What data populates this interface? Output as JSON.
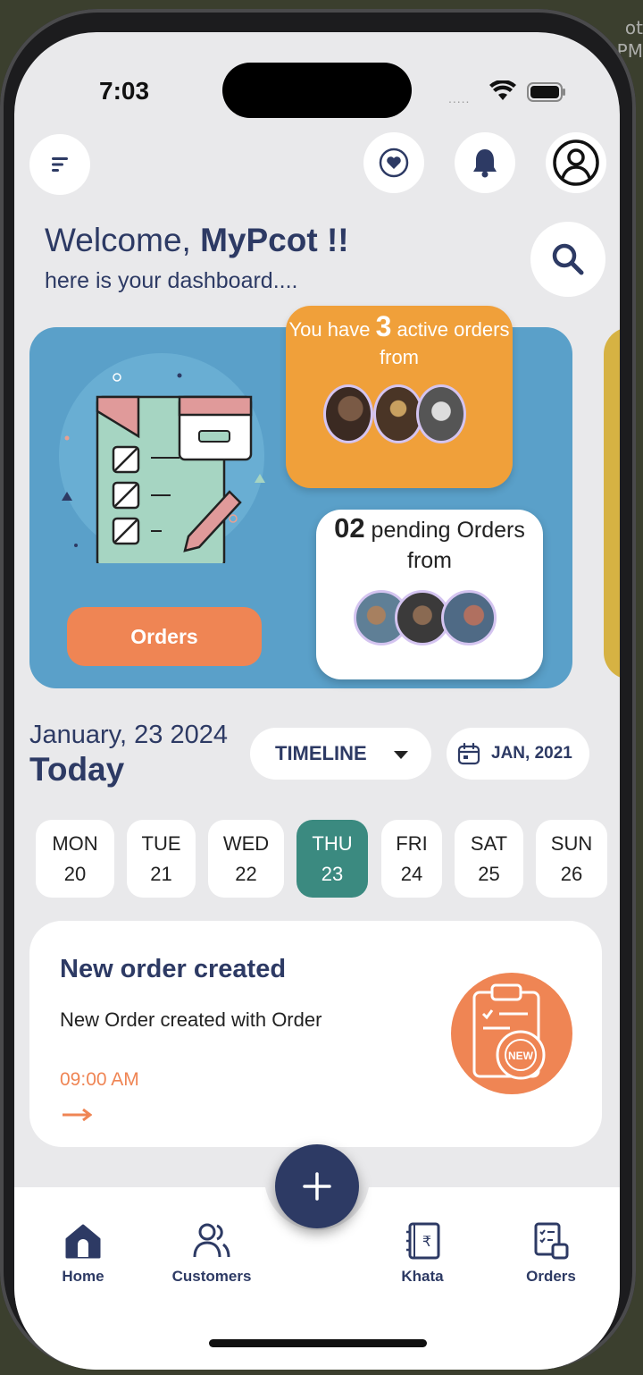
{
  "background_text": {
    "line1": "ot",
    "line2": "PM"
  },
  "status_bar": {
    "time": "7:03",
    "signal_dots": "....."
  },
  "header": {
    "menu_icon": "menu-icon",
    "favorite_icon": "heart-icon",
    "notification_icon": "bell-icon",
    "profile_icon": "user-circle-icon",
    "search_icon": "search-icon"
  },
  "greeting": {
    "prefix": "Welcome, ",
    "name": "MyPcot !!",
    "subtitle": "here is your dashboard...."
  },
  "hero": {
    "orders_button": "Orders",
    "active": {
      "text_before": "You have ",
      "count": "3",
      "text_after": " active orders from"
    },
    "pending": {
      "count": "02",
      "text_after": " pending Orders from"
    },
    "colors": {
      "card": "#5aa0c9",
      "active": "#f0a03a",
      "button": "#ef8554",
      "next_card": "#d6b243"
    }
  },
  "date_section": {
    "month_label": "January, 23 2024",
    "today_label": "Today",
    "timeline_label": "TIMELINE",
    "date_picker_label": "JAN, 2021"
  },
  "week": [
    {
      "day": "MON",
      "date": "20",
      "active": false
    },
    {
      "day": "TUE",
      "date": "21",
      "active": false
    },
    {
      "day": "WED",
      "date": "22",
      "active": false
    },
    {
      "day": "THU",
      "date": "23",
      "active": true
    },
    {
      "day": "FRI",
      "date": "24",
      "active": false
    },
    {
      "day": "SAT",
      "date": "25",
      "active": false
    },
    {
      "day": "SUN",
      "date": "26",
      "active": false
    }
  ],
  "order_card": {
    "title": "New order created",
    "description": "New Order created with Order",
    "time": "09:00 AM",
    "badge_text": "NEW"
  },
  "bottom_nav": {
    "items": [
      {
        "label": "Home",
        "icon": "home-icon"
      },
      {
        "label": "Customers",
        "icon": "users-icon"
      },
      {
        "label": "Khata",
        "icon": "ledger-icon"
      },
      {
        "label": "Orders",
        "icon": "orders-icon"
      }
    ],
    "fab_icon": "plus-icon",
    "accent": "#2d3a64"
  }
}
